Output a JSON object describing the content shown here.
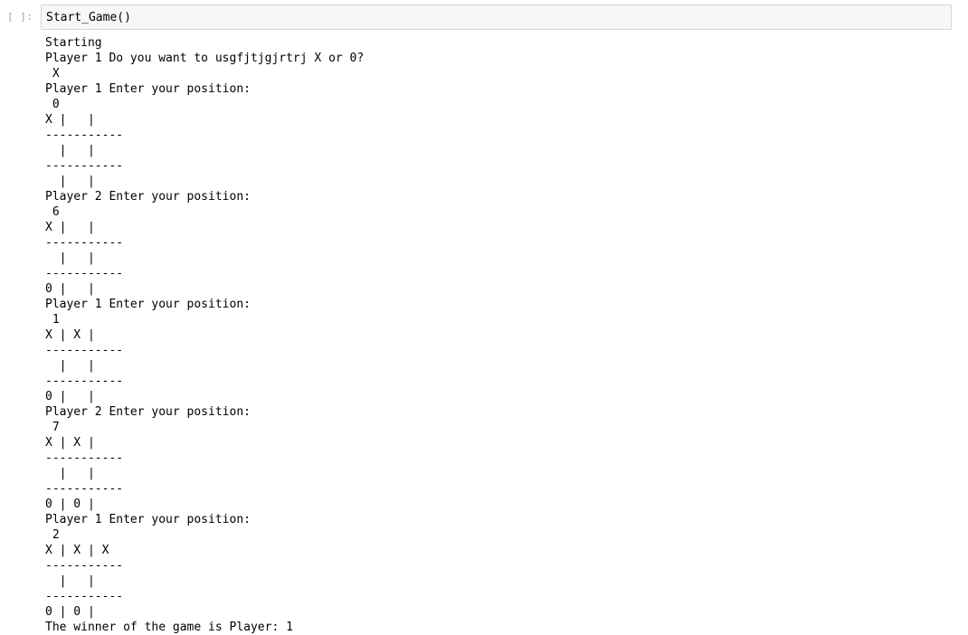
{
  "cell": {
    "prompt": "[ ]:",
    "code": "Start_Game()"
  },
  "output_lines": [
    "Starting",
    "Player 1 Do you want to usgfjtjgjrtrj X or 0?",
    " X",
    "Player 1 Enter your position:",
    " 0",
    "X |   |",
    "-----------",
    "  |   |",
    "-----------",
    "  |   |",
    "Player 2 Enter your position:",
    " 6",
    "X |   |",
    "-----------",
    "  |   |",
    "-----------",
    "0 |   |",
    "Player 1 Enter your position:",
    " 1",
    "X | X |",
    "-----------",
    "  |   |",
    "-----------",
    "0 |   |",
    "Player 2 Enter your position:",
    " 7",
    "X | X |",
    "-----------",
    "  |   |",
    "-----------",
    "0 | 0 |",
    "Player 1 Enter your position:",
    " 2",
    "X | X | X",
    "-----------",
    "  |   |",
    "-----------",
    "0 | 0 |",
    "The winner of the game is Player: 1"
  ]
}
